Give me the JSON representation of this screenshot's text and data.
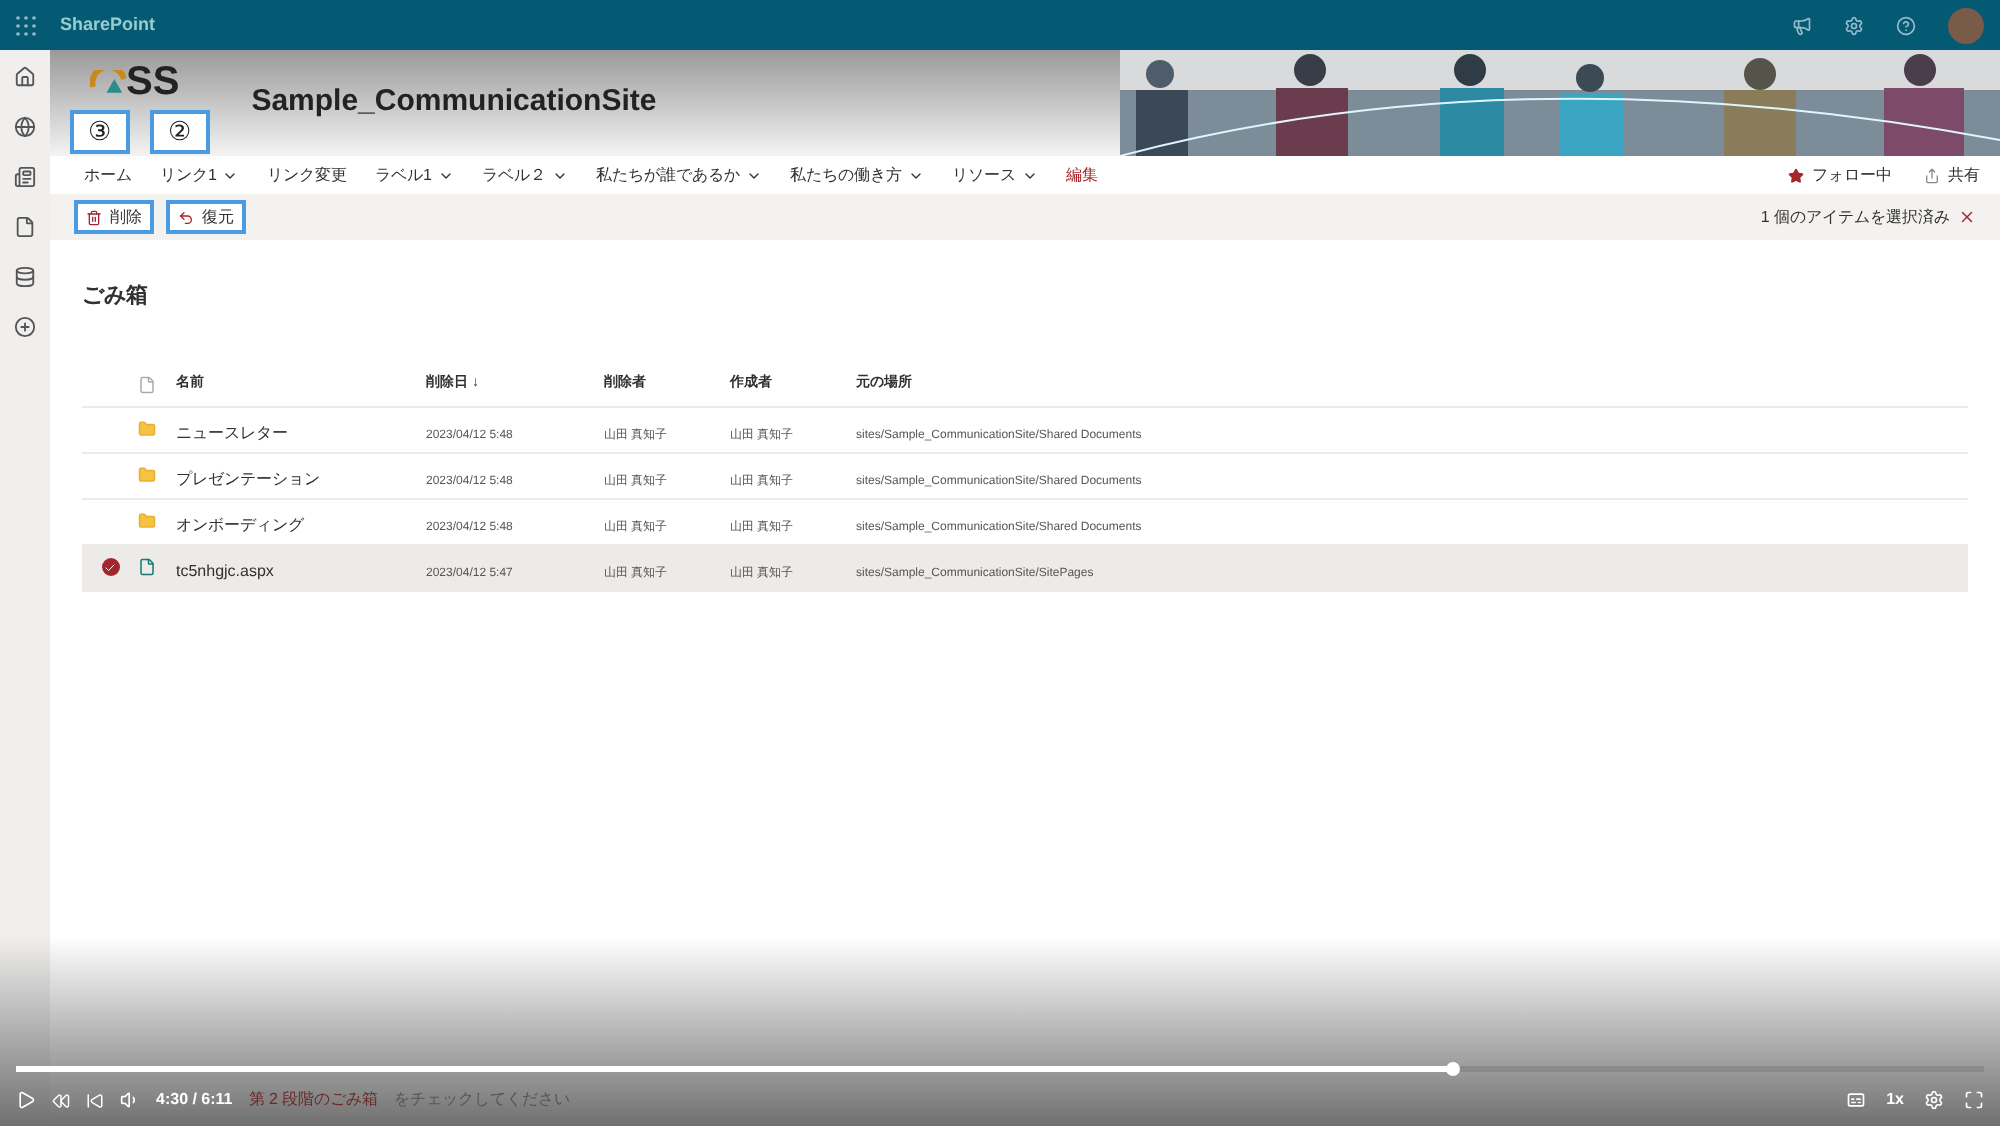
{
  "suite_bar": {
    "app_name": "SharePoint"
  },
  "site": {
    "title": "Sample_CommunicationSite",
    "logo_text": "SS"
  },
  "nav": [
    {
      "label": "ホーム",
      "dropdown": false,
      "kind": "link"
    },
    {
      "label": "リンク1",
      "dropdown": true,
      "kind": "link"
    },
    {
      "label": "リンク変更",
      "dropdown": false,
      "kind": "link"
    },
    {
      "label": "ラベル1",
      "dropdown": true,
      "kind": "link"
    },
    {
      "label": "ラベル２",
      "dropdown": true,
      "kind": "link"
    },
    {
      "label": "私たちが誰であるか",
      "dropdown": true,
      "kind": "link"
    },
    {
      "label": "私たちの働き方",
      "dropdown": true,
      "kind": "link"
    },
    {
      "label": "リソース",
      "dropdown": true,
      "kind": "link"
    },
    {
      "label": "編集",
      "dropdown": false,
      "kind": "edit"
    }
  ],
  "site_actions": [
    {
      "label": "フォロー中",
      "kind": "follow"
    },
    {
      "label": "共有",
      "kind": "share"
    }
  ],
  "command_bar": {
    "buttons": [
      {
        "label": "削除",
        "kind": "delete"
      },
      {
        "label": "復元",
        "kind": "restore"
      }
    ],
    "selection": "1 個のアイテムを選択済み"
  },
  "callouts": [
    "③",
    "②"
  ],
  "page_title": "ごみ箱",
  "table": {
    "columns": [
      "名前",
      "削除日 ↓",
      "削除者",
      "作成者",
      "元の場所"
    ],
    "rows": [
      {
        "kind": "folder",
        "selected": false,
        "cells": [
          "ニュースレター",
          "2023/04/12 5:48",
          "山田 真知子",
          "山田 真知子",
          "sites/Sample_CommunicationSite/Shared Documents"
        ]
      },
      {
        "kind": "folder",
        "selected": false,
        "cells": [
          "プレゼンテーション",
          "2023/04/12 5:48",
          "山田 真知子",
          "山田 真知子",
          "sites/Sample_CommunicationSite/Shared Documents"
        ]
      },
      {
        "kind": "folder",
        "selected": false,
        "cells": [
          "オンボーディング",
          "2023/04/12 5:48",
          "山田 真知子",
          "山田 真知子",
          "sites/Sample_CommunicationSite/Shared Documents"
        ]
      },
      {
        "kind": "page",
        "selected": true,
        "cells": [
          "tc5nhgjc.aspx",
          "2023/04/12 5:47",
          "山田 真知子",
          "山田 真知子",
          "sites/Sample_CommunicationSite/SitePages"
        ]
      }
    ]
  },
  "player": {
    "time": "4:30 / 6:11",
    "level": 0.73,
    "hint_link": "第 2 段階のごみ箱",
    "hint_text": "をチェックしてください",
    "speed": "1x"
  }
}
